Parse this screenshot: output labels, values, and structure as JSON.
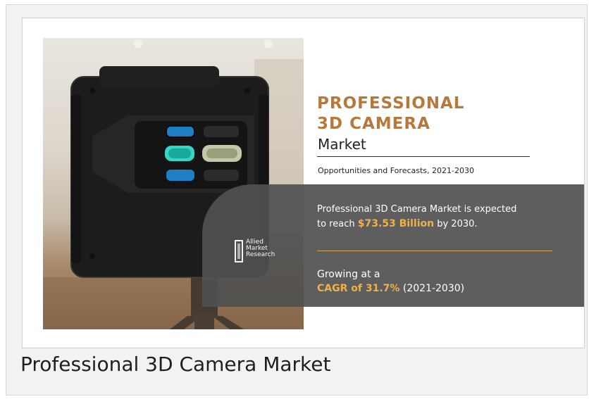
{
  "infographic": {
    "title_line1": "PROFESSIONAL",
    "title_line2": "3D CAMERA",
    "subtitle": "Market",
    "forecast_label": "Opportunities and Forecasts, 2021-2030",
    "stat1_prefix": "Professional 3D Camera Market is expected",
    "stat1_line2_prefix": "to reach ",
    "stat1_value": "$73.53 Billion",
    "stat1_suffix": " by 2030.",
    "stat2_prefix": "Growing at a",
    "stat2_value": "CAGR of 31.7%",
    "stat2_suffix": " (2021-2030)",
    "logo_line1": "Allied",
    "logo_line2": "Market",
    "logo_line3": "Research"
  },
  "caption": "Professional 3D Camera Market",
  "colors": {
    "title": "#b6783b",
    "highlight": "#f0b04a",
    "panel": "#505050",
    "gold_rule": "#d8a658"
  }
}
